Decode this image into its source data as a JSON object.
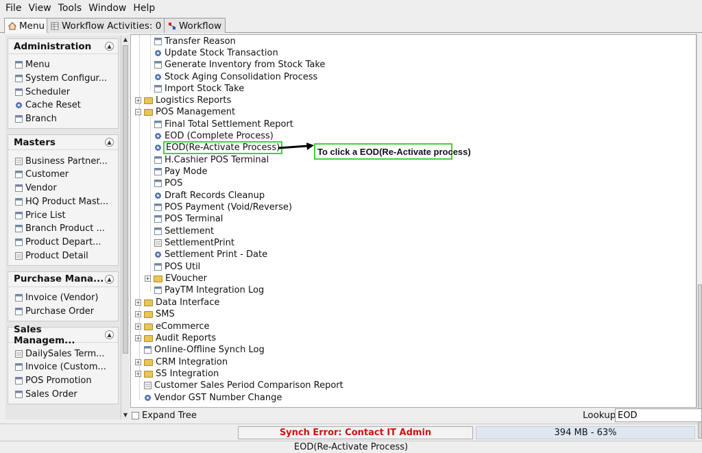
{
  "menubar": {
    "items": [
      "File",
      "View",
      "Tools",
      "Window",
      "Help"
    ]
  },
  "tabs": [
    {
      "label": "Menu"
    },
    {
      "label": "Workflow Activities: 0"
    },
    {
      "label": "Workflow"
    }
  ],
  "sidebar": {
    "sections": [
      {
        "title": "Administration",
        "items": [
          "Menu",
          "System Configur...",
          "Scheduler",
          "Cache Reset",
          "Branch"
        ]
      },
      {
        "title": "Masters",
        "items": [
          "Business Partner...",
          "Customer",
          "Vendor",
          "HQ Product Mast...",
          "Price List",
          "Branch Product ...",
          "Product Depart...",
          "Product Detail"
        ]
      },
      {
        "title": "Purchase Mana...",
        "items": [
          "Invoice (Vendor)",
          "Purchase Order"
        ]
      },
      {
        "title": "Sales Managem...",
        "items": [
          "DailySales Term...",
          "Invoice (Custom...",
          "POS Promotion",
          "Sales Order"
        ]
      }
    ]
  },
  "tree": {
    "nodes": [
      "Transfer Reason",
      "Update Stock Transaction",
      "Generate Inventory from Stock Take",
      "Stock Aging Consolidation Process",
      "Import Stock Take",
      "Logistics Reports",
      "POS Management",
      "Final Total Settlement Report",
      "EOD (Complete Process)",
      "EOD(Re-Activate Process)",
      "H.Cashier POS Terminal",
      "Pay Mode",
      "POS",
      "Draft Records Cleanup",
      "POS Payment (Void/Reverse)",
      "POS Terminal",
      "Settlement",
      "SettlementPrint",
      "Settlement Print - Date",
      "POS Util",
      "EVoucher",
      "PayTM Integration Log",
      "Data Interface",
      "SMS",
      "eCommerce",
      "Audit Reports",
      "Online-Offline Synch Log",
      "CRM Integration",
      "SS Integration",
      "Customer Sales Period Comparison Report",
      "Vendor GST Number Change"
    ]
  },
  "annotation": {
    "text": "To click a EOD(Re-Activate process)"
  },
  "footer": {
    "expand_label": "Expand Tree",
    "lookup_label": "Lookup",
    "lookup_value": "EOD"
  },
  "status": {
    "sync_error": "Synch Error: Contact IT Admin",
    "memory": "394 MB - 63%",
    "selected": "EOD(Re-Activate Process)"
  },
  "colors": {
    "highlight": "#3bd43b",
    "error": "#cc1111"
  }
}
